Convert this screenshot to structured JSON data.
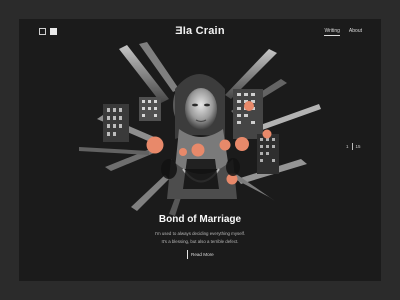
{
  "header": {
    "logo": "ƎIa Crain",
    "view_toggles": [
      "grid-view-icon",
      "single-view-icon"
    ],
    "nav": [
      {
        "label": "Writing",
        "active": true
      },
      {
        "label": "About",
        "active": false
      }
    ]
  },
  "slider": {
    "current": "1",
    "total": "15"
  },
  "post": {
    "title": "Bond of Marriage",
    "excerpt_line1": "I'm used to always deciding everything myself.",
    "excerpt_line2": "It's a blessing, but also a terrible defect.",
    "cta": "Read More"
  },
  "colors": {
    "page_bg": "#2b2b2b",
    "panel_bg": "#1b1b1b",
    "accent": "#e8896a"
  }
}
